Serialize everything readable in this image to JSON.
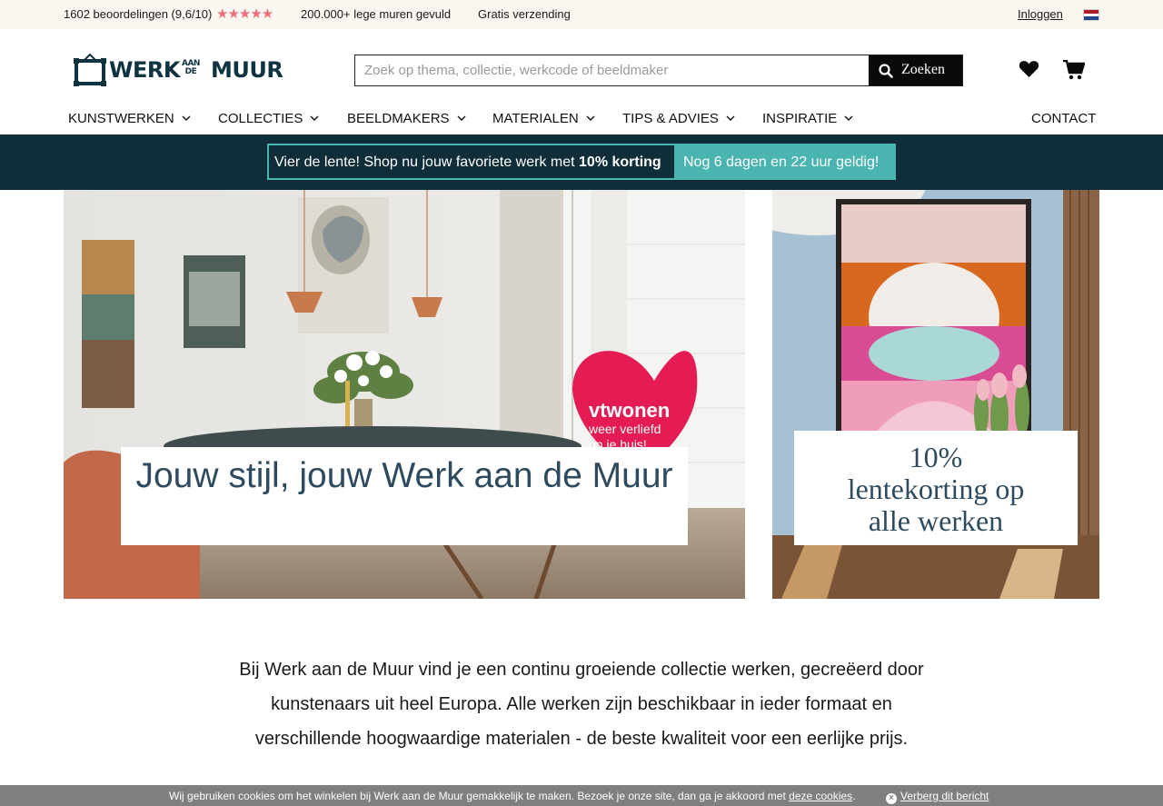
{
  "topbar": {
    "reviews": "1602 beoordelingen (9,6/10)",
    "rating_stars": 5,
    "walls": "200.000+ lege muren gevuld",
    "shipping": "Gratis verzending",
    "login": "Inloggen",
    "flag_colors": [
      "#ae1c28",
      "#ffffff",
      "#21468b"
    ]
  },
  "logo": {
    "text_left": "WERK",
    "small_top": "AAN",
    "small_bottom": "DE",
    "text_right": "MUUR"
  },
  "search": {
    "placeholder": "Zoek op thema, collectie, werkcode of beeldmaker",
    "button_label": "Zoeken"
  },
  "header_icons": [
    "heart-icon",
    "cart-icon"
  ],
  "nav": {
    "items": [
      {
        "label": "KUNSTWERKEN"
      },
      {
        "label": "COLLECTIES"
      },
      {
        "label": "BEELDMAKERS"
      },
      {
        "label": "MATERIALEN"
      },
      {
        "label": "TIPS & ADVIES"
      },
      {
        "label": "INSPIRATIE"
      }
    ],
    "contact": "CONTACT"
  },
  "promo": {
    "text": "Vier de lente! Shop nu jouw favoriete werk met",
    "discount": "10% korting",
    "timer": "Nog 6 dagen en 22 uur geldig!"
  },
  "hero": {
    "left_caption": "Jouw stijl, jouw Werk aan de Muur",
    "heart_sign_brand": "vtwonen",
    "heart_sign_line1": "weer verliefd",
    "heart_sign_line2": "op je huis!",
    "right_caption_line1": "10%",
    "right_caption_line2": "lentekorting op",
    "right_caption_line3": "alle werken"
  },
  "intro": {
    "text": "Bij Werk aan de Muur vind je een continu groeiende collectie werken, gecreëerd door kunstenaars uit heel Europa. Alle werken zijn beschikbaar in ieder formaat en verschillende hoogwaardige materialen - de beste kwaliteit voor een eerlijke prijs."
  },
  "cookie": {
    "text": "Wij gebruiken cookies om het winkelen bij Werk aan de Muur gemakkelijk te maken. Bezoek je onze site, dan ga je akkoord met",
    "link": "deze cookies",
    "period": ".",
    "close": "Verberg dit bericht"
  },
  "colors": {
    "accent_teal": "#4ab5b0",
    "dark_navy": "#0f2e3a",
    "caption_text": "#2e4a5e",
    "star_pink": "#f06e7a"
  }
}
